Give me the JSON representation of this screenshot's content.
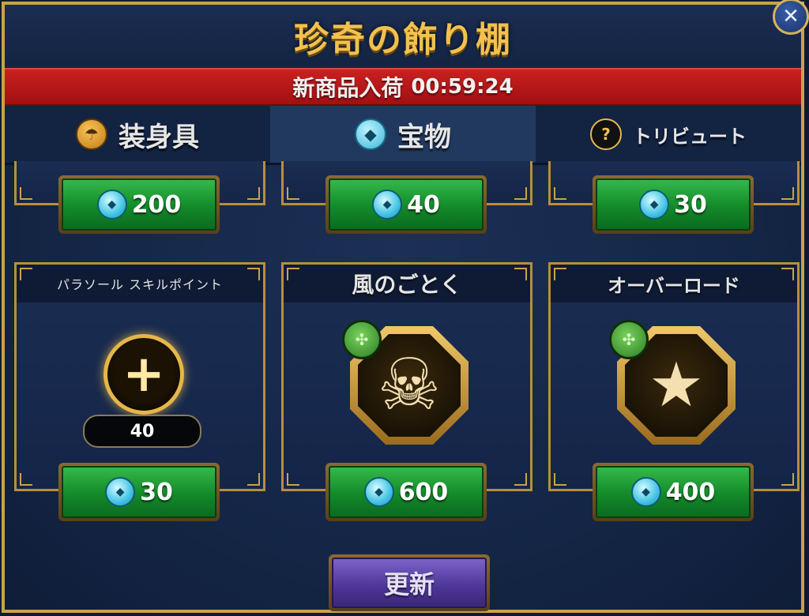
{
  "window": {
    "title": "珍奇の飾り棚",
    "close_symbol": "✕"
  },
  "restock": {
    "label": "新商品入荷",
    "time": "00:59:24"
  },
  "tabs": [
    {
      "label": "装身具",
      "icon": "umbrella-coin-icon",
      "active": false
    },
    {
      "label": "宝物",
      "icon": "gem-icon",
      "active": true
    },
    {
      "label": "トリビュート",
      "icon": "question-icon",
      "active": false
    }
  ],
  "top_row": [
    {
      "price": "200",
      "currency_icon": "gem-icon"
    },
    {
      "price": "40",
      "currency_icon": "gem-icon"
    },
    {
      "price": "30",
      "currency_icon": "gem-icon"
    }
  ],
  "items": [
    {
      "name": "パラソール スキルポイント",
      "icon": "plus-icon",
      "count": "40",
      "price": "30",
      "currency_icon": "gem-icon"
    },
    {
      "name": "風のごとく",
      "icon": "skull-icon",
      "badge": "triskelion-icon",
      "price": "600",
      "currency_icon": "gem-icon"
    },
    {
      "name": "オーバーロード",
      "icon": "star-orbit-icon",
      "badge": "triskelion-icon",
      "price": "400",
      "currency_icon": "gem-icon"
    }
  ],
  "refresh_label": "更新",
  "colors": {
    "gold": "#c9a24a",
    "timer_red": "#c8211f",
    "buy_green": "#138a2a",
    "refresh_purple": "#4c3596",
    "panel_navy": "#152748"
  }
}
